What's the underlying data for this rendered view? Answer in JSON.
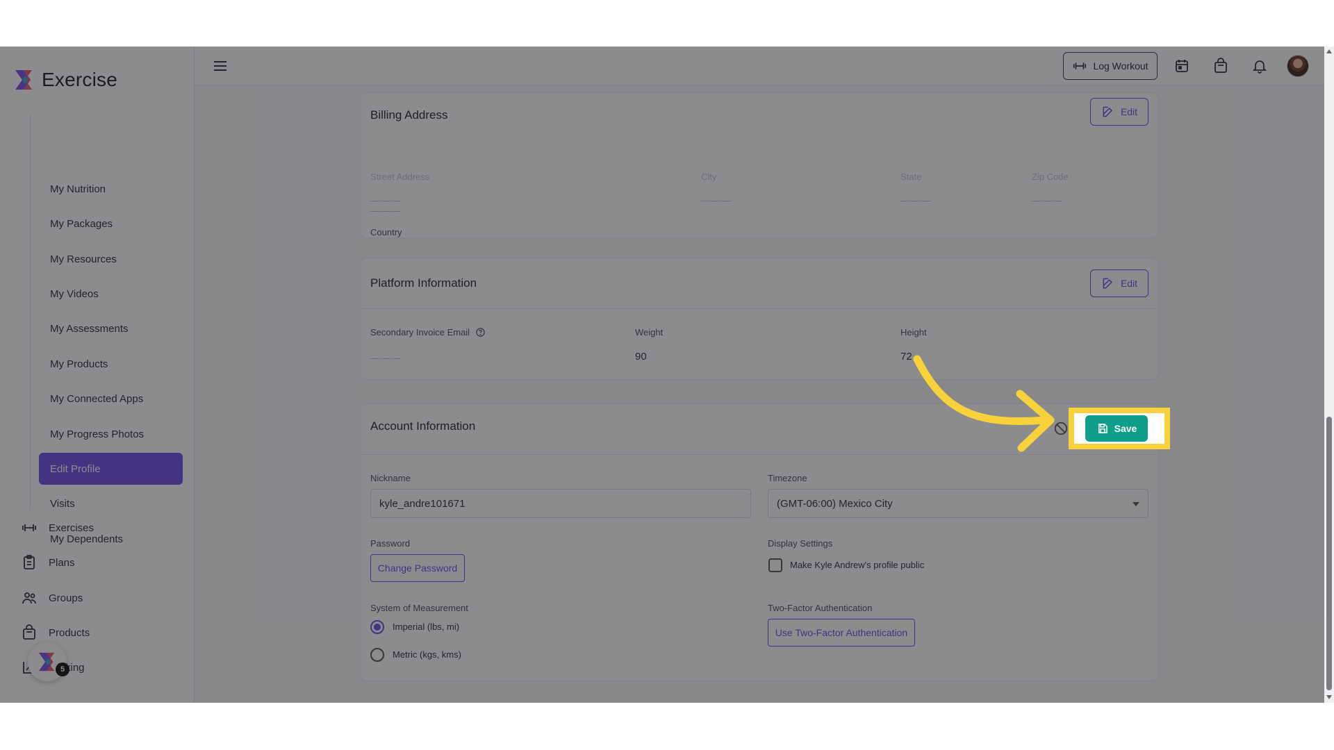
{
  "brand": {
    "name": "Exercise"
  },
  "sidebar": {
    "sub_items": [
      {
        "label": "My Nutrition"
      },
      {
        "label": "My Packages"
      },
      {
        "label": "My Resources"
      },
      {
        "label": "My Videos"
      },
      {
        "label": "My Assessments"
      },
      {
        "label": "My Products"
      },
      {
        "label": "My Connected Apps"
      },
      {
        "label": "My Progress Photos"
      },
      {
        "label": "Edit Profile",
        "active": true
      },
      {
        "label": "Visits"
      },
      {
        "label": "My Dependents"
      }
    ],
    "main_items": [
      {
        "label": "Exercises",
        "icon": "dumbbell-icon"
      },
      {
        "label": "Plans",
        "icon": "clipboard-icon"
      },
      {
        "label": "Groups",
        "icon": "users-icon"
      },
      {
        "label": "Products",
        "icon": "bag-icon"
      },
      {
        "label": "king",
        "icon": "chart-icon"
      }
    ],
    "badge_count": "5"
  },
  "header": {
    "log_workout_label": "Log Workout",
    "icons": [
      "calendar-icon",
      "bag-icon",
      "bell-icon"
    ]
  },
  "billing": {
    "title": "Billing Address",
    "edit_label": "Edit",
    "columns": [
      {
        "label": "Street Address",
        "value": "———"
      },
      {
        "label": "City",
        "value": "———"
      },
      {
        "label": "State",
        "value": "———"
      },
      {
        "label": "Zip Code",
        "value": "———"
      }
    ],
    "country_label": "Country",
    "country_value": "———"
  },
  "platform": {
    "title": "Platform Information",
    "edit_label": "Edit",
    "secondary_email_label": "Secondary Invoice Email",
    "secondary_email_value": "———",
    "weight_label": "Weight",
    "weight_value": "90",
    "height_label": "Height",
    "height_value": "72"
  },
  "account": {
    "title": "Account Information",
    "save_label": "Save",
    "nickname_label": "Nickname",
    "nickname_value": "kyle_andre101671",
    "timezone_label": "Timezone",
    "timezone_value": "(GMT-06:00) Mexico City",
    "password_label": "Password",
    "change_password_label": "Change Password",
    "display_settings_label": "Display Settings",
    "public_profile_label": "Make Kyle Andrew's profile public",
    "measurement_label": "System of Measurement",
    "measurement_options": [
      {
        "label": "Imperial (lbs, mi)",
        "selected": true
      },
      {
        "label": "Metric (kgs, kms)",
        "selected": false
      }
    ],
    "two_factor_label": "Two-Factor Authentication",
    "two_factor_button": "Use Two-Factor Authentication"
  },
  "colors": {
    "accent": "#6c4de6",
    "save": "#0f9e8a",
    "highlight": "#f8d23a"
  }
}
